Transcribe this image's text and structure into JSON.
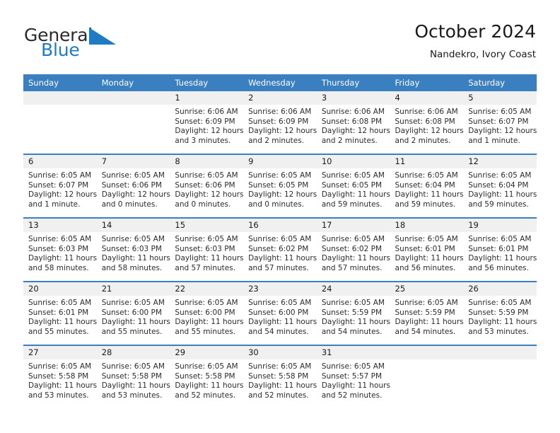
{
  "brand": {
    "name_top": "General",
    "name_bottom": "Blue",
    "accent_color": "#1e7bc4",
    "logo_icon": "triangle-flag-icon"
  },
  "header": {
    "title": "October 2024",
    "subtitle": "Nandekro, Ivory Coast"
  },
  "theme": {
    "header_blue": "#3a7fbf",
    "daynum_background": "#f0f0f0",
    "text": "#2b2b2b"
  },
  "weekday_headers": [
    "Sunday",
    "Monday",
    "Tuesday",
    "Wednesday",
    "Thursday",
    "Friday",
    "Saturday"
  ],
  "weeks": [
    [
      {
        "day": "",
        "sunrise": "",
        "sunset": "",
        "daylight_line1": "",
        "daylight_line2": ""
      },
      {
        "day": "",
        "sunrise": "",
        "sunset": "",
        "daylight_line1": "",
        "daylight_line2": ""
      },
      {
        "day": "1",
        "sunrise": "Sunrise: 6:06 AM",
        "sunset": "Sunset: 6:09 PM",
        "daylight_line1": "Daylight: 12 hours",
        "daylight_line2": "and 3 minutes."
      },
      {
        "day": "2",
        "sunrise": "Sunrise: 6:06 AM",
        "sunset": "Sunset: 6:09 PM",
        "daylight_line1": "Daylight: 12 hours",
        "daylight_line2": "and 2 minutes."
      },
      {
        "day": "3",
        "sunrise": "Sunrise: 6:06 AM",
        "sunset": "Sunset: 6:08 PM",
        "daylight_line1": "Daylight: 12 hours",
        "daylight_line2": "and 2 minutes."
      },
      {
        "day": "4",
        "sunrise": "Sunrise: 6:06 AM",
        "sunset": "Sunset: 6:08 PM",
        "daylight_line1": "Daylight: 12 hours",
        "daylight_line2": "and 2 minutes."
      },
      {
        "day": "5",
        "sunrise": "Sunrise: 6:05 AM",
        "sunset": "Sunset: 6:07 PM",
        "daylight_line1": "Daylight: 12 hours",
        "daylight_line2": "and 1 minute."
      }
    ],
    [
      {
        "day": "6",
        "sunrise": "Sunrise: 6:05 AM",
        "sunset": "Sunset: 6:07 PM",
        "daylight_line1": "Daylight: 12 hours",
        "daylight_line2": "and 1 minute."
      },
      {
        "day": "7",
        "sunrise": "Sunrise: 6:05 AM",
        "sunset": "Sunset: 6:06 PM",
        "daylight_line1": "Daylight: 12 hours",
        "daylight_line2": "and 0 minutes."
      },
      {
        "day": "8",
        "sunrise": "Sunrise: 6:05 AM",
        "sunset": "Sunset: 6:06 PM",
        "daylight_line1": "Daylight: 12 hours",
        "daylight_line2": "and 0 minutes."
      },
      {
        "day": "9",
        "sunrise": "Sunrise: 6:05 AM",
        "sunset": "Sunset: 6:05 PM",
        "daylight_line1": "Daylight: 12 hours",
        "daylight_line2": "and 0 minutes."
      },
      {
        "day": "10",
        "sunrise": "Sunrise: 6:05 AM",
        "sunset": "Sunset: 6:05 PM",
        "daylight_line1": "Daylight: 11 hours",
        "daylight_line2": "and 59 minutes."
      },
      {
        "day": "11",
        "sunrise": "Sunrise: 6:05 AM",
        "sunset": "Sunset: 6:04 PM",
        "daylight_line1": "Daylight: 11 hours",
        "daylight_line2": "and 59 minutes."
      },
      {
        "day": "12",
        "sunrise": "Sunrise: 6:05 AM",
        "sunset": "Sunset: 6:04 PM",
        "daylight_line1": "Daylight: 11 hours",
        "daylight_line2": "and 59 minutes."
      }
    ],
    [
      {
        "day": "13",
        "sunrise": "Sunrise: 6:05 AM",
        "sunset": "Sunset: 6:03 PM",
        "daylight_line1": "Daylight: 11 hours",
        "daylight_line2": "and 58 minutes."
      },
      {
        "day": "14",
        "sunrise": "Sunrise: 6:05 AM",
        "sunset": "Sunset: 6:03 PM",
        "daylight_line1": "Daylight: 11 hours",
        "daylight_line2": "and 58 minutes."
      },
      {
        "day": "15",
        "sunrise": "Sunrise: 6:05 AM",
        "sunset": "Sunset: 6:03 PM",
        "daylight_line1": "Daylight: 11 hours",
        "daylight_line2": "and 57 minutes."
      },
      {
        "day": "16",
        "sunrise": "Sunrise: 6:05 AM",
        "sunset": "Sunset: 6:02 PM",
        "daylight_line1": "Daylight: 11 hours",
        "daylight_line2": "and 57 minutes."
      },
      {
        "day": "17",
        "sunrise": "Sunrise: 6:05 AM",
        "sunset": "Sunset: 6:02 PM",
        "daylight_line1": "Daylight: 11 hours",
        "daylight_line2": "and 57 minutes."
      },
      {
        "day": "18",
        "sunrise": "Sunrise: 6:05 AM",
        "sunset": "Sunset: 6:01 PM",
        "daylight_line1": "Daylight: 11 hours",
        "daylight_line2": "and 56 minutes."
      },
      {
        "day": "19",
        "sunrise": "Sunrise: 6:05 AM",
        "sunset": "Sunset: 6:01 PM",
        "daylight_line1": "Daylight: 11 hours",
        "daylight_line2": "and 56 minutes."
      }
    ],
    [
      {
        "day": "20",
        "sunrise": "Sunrise: 6:05 AM",
        "sunset": "Sunset: 6:01 PM",
        "daylight_line1": "Daylight: 11 hours",
        "daylight_line2": "and 55 minutes."
      },
      {
        "day": "21",
        "sunrise": "Sunrise: 6:05 AM",
        "sunset": "Sunset: 6:00 PM",
        "daylight_line1": "Daylight: 11 hours",
        "daylight_line2": "and 55 minutes."
      },
      {
        "day": "22",
        "sunrise": "Sunrise: 6:05 AM",
        "sunset": "Sunset: 6:00 PM",
        "daylight_line1": "Daylight: 11 hours",
        "daylight_line2": "and 55 minutes."
      },
      {
        "day": "23",
        "sunrise": "Sunrise: 6:05 AM",
        "sunset": "Sunset: 6:00 PM",
        "daylight_line1": "Daylight: 11 hours",
        "daylight_line2": "and 54 minutes."
      },
      {
        "day": "24",
        "sunrise": "Sunrise: 6:05 AM",
        "sunset": "Sunset: 5:59 PM",
        "daylight_line1": "Daylight: 11 hours",
        "daylight_line2": "and 54 minutes."
      },
      {
        "day": "25",
        "sunrise": "Sunrise: 6:05 AM",
        "sunset": "Sunset: 5:59 PM",
        "daylight_line1": "Daylight: 11 hours",
        "daylight_line2": "and 54 minutes."
      },
      {
        "day": "26",
        "sunrise": "Sunrise: 6:05 AM",
        "sunset": "Sunset: 5:59 PM",
        "daylight_line1": "Daylight: 11 hours",
        "daylight_line2": "and 53 minutes."
      }
    ],
    [
      {
        "day": "27",
        "sunrise": "Sunrise: 6:05 AM",
        "sunset": "Sunset: 5:58 PM",
        "daylight_line1": "Daylight: 11 hours",
        "daylight_line2": "and 53 minutes."
      },
      {
        "day": "28",
        "sunrise": "Sunrise: 6:05 AM",
        "sunset": "Sunset: 5:58 PM",
        "daylight_line1": "Daylight: 11 hours",
        "daylight_line2": "and 53 minutes."
      },
      {
        "day": "29",
        "sunrise": "Sunrise: 6:05 AM",
        "sunset": "Sunset: 5:58 PM",
        "daylight_line1": "Daylight: 11 hours",
        "daylight_line2": "and 52 minutes."
      },
      {
        "day": "30",
        "sunrise": "Sunrise: 6:05 AM",
        "sunset": "Sunset: 5:58 PM",
        "daylight_line1": "Daylight: 11 hours",
        "daylight_line2": "and 52 minutes."
      },
      {
        "day": "31",
        "sunrise": "Sunrise: 6:05 AM",
        "sunset": "Sunset: 5:57 PM",
        "daylight_line1": "Daylight: 11 hours",
        "daylight_line2": "and 52 minutes."
      },
      {
        "day": "",
        "sunrise": "",
        "sunset": "",
        "daylight_line1": "",
        "daylight_line2": ""
      },
      {
        "day": "",
        "sunrise": "",
        "sunset": "",
        "daylight_line1": "",
        "daylight_line2": ""
      }
    ]
  ]
}
